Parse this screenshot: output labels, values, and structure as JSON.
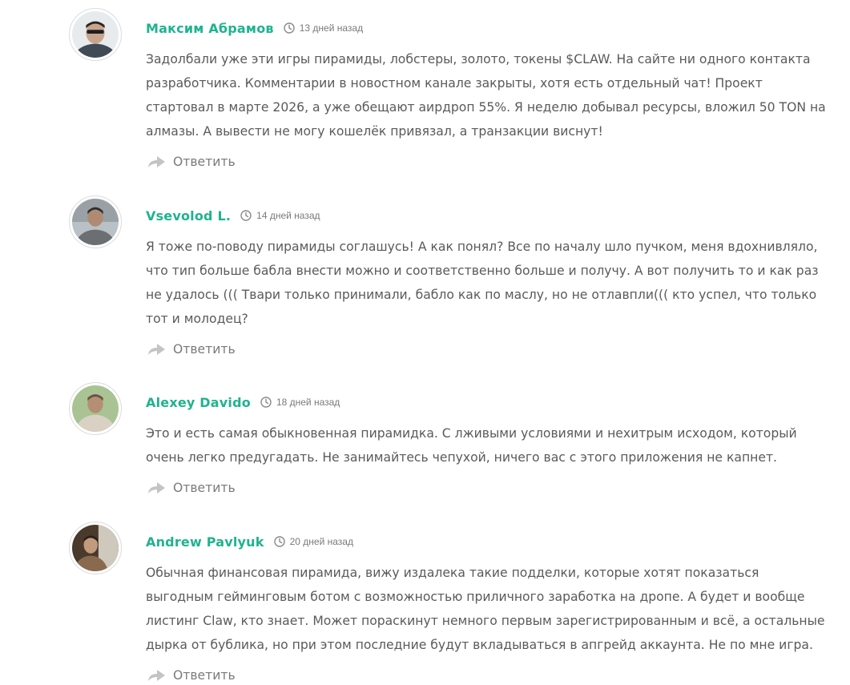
{
  "comments": [
    {
      "author": "Максим Абрамов",
      "time": "13 дней назад",
      "text": "Задолбали уже эти игры пирамиды, лобстеры, золото, токены $CLAW. На сайте ни одного контакта разработчика. Комментарии в новостном канале закрыты, хотя есть отдельный чат! Проект стартовал в марте 2026, а уже обещают аирдроп 55%. Я неделю добывал ресурсы, вложил 50 TON на алмазы. А вывести не могу кошелёк привязал, а транзакции виснут!",
      "reply_label": "Ответить",
      "avatar_colors": [
        "#3f4a56",
        "#c9a48a",
        "#1d1f24"
      ]
    },
    {
      "author": "Vsevolod L.",
      "time": "14 дней назад",
      "text": "Я тоже по-поводу пирамиды соглашусь! А как понял? Все по началу шло пучком, меня вдохнивляло, что тип больше бабла внести можно и соответственно больше и получу. А вот получить то и как раз не удалось ((( Твари только принимали, бабло как по маслу, но не отлавпли((( кто успел, что только тот и молодец?",
      "reply_label": "Ответить",
      "avatar_colors": [
        "#9aa1a6",
        "#6b6f72",
        "#2c2f33"
      ]
    },
    {
      "author": "Alexey Davido",
      "time": "18 дней назад",
      "text": "Это и есть самая обыкновенная пирамидка. С лживыми условиями и нехитрым исходом, который очень легко предугадать. Не занимайтесь чепухой, ничего вас с этого приложения не капнет.",
      "reply_label": "Ответить",
      "avatar_colors": [
        "#8fb07a",
        "#d9d2c4",
        "#b58f74"
      ]
    },
    {
      "author": "Andrew Pavlyuk",
      "time": "20 дней назад",
      "text": "Обычная финансовая пирамида, вижу издалека такие подделки, которые хотят показаться выгодным гейминговым ботом с возможностью приличного заработка на дропе. А будет и вообще листинг Claw, кто знает. Может пораскинут немного первым зарегистрированным и всё, а остальные дырка от бублика, но при этом последние будут вкладываться в апгрейд аккаунта. Не по мне игра.",
      "reply_label": "Ответить",
      "avatar_colors": [
        "#4a3a2c",
        "#cfc8bc",
        "#8a6a4e"
      ]
    }
  ],
  "colors": {
    "author": "#1fb38e",
    "text": "#5a5a5a",
    "meta": "#7a7a7a"
  }
}
